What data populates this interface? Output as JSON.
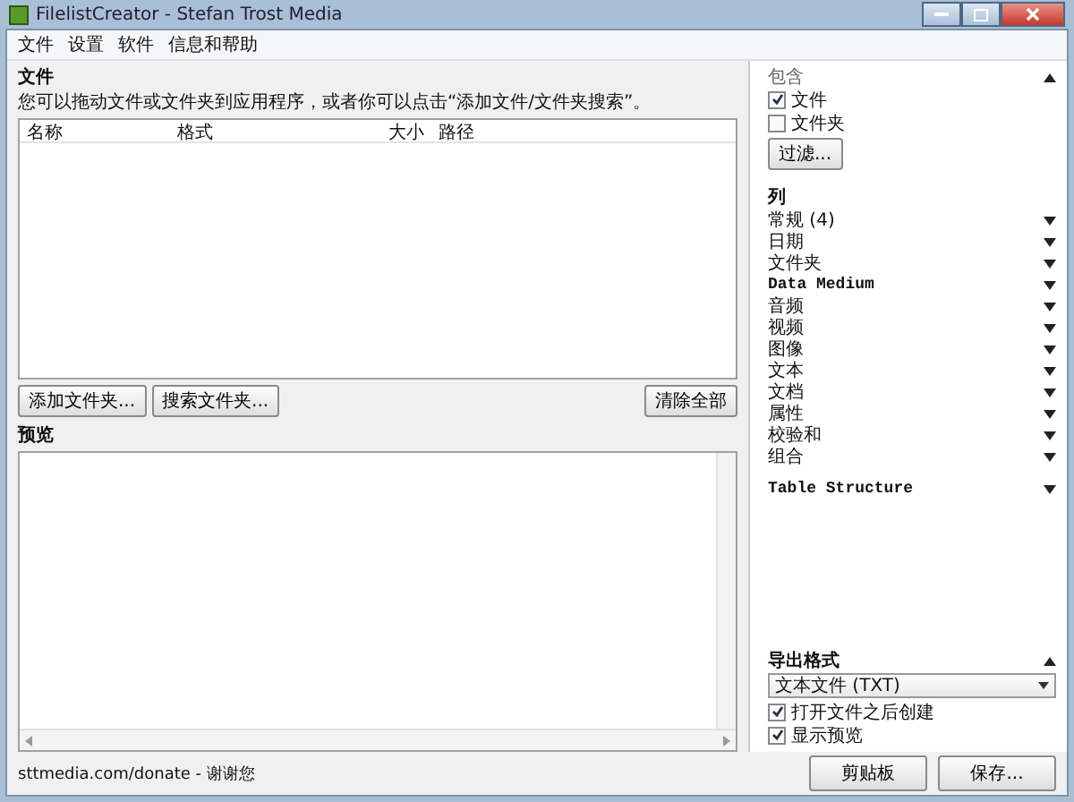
{
  "window": {
    "title": "FilelistCreator - Stefan Trost Media"
  },
  "menu": [
    "文件",
    "设置",
    "软件",
    "信息和帮助"
  ],
  "files": {
    "heading": "文件",
    "description": "您可以拖动文件或文件夹到应用程序，或者你可以点击“添加文件/文件夹搜索”。",
    "columns": [
      "名称",
      "格式",
      "大小",
      "路径"
    ],
    "buttons": [
      "添加文件夹...",
      "搜索文件夹..."
    ],
    "clear_button": "清除全部"
  },
  "preview": {
    "heading": "预览"
  },
  "include": {
    "title": "包含",
    "expanded": true,
    "options": [
      {
        "label": "文件",
        "checked": true
      },
      {
        "label": "文件夹",
        "checked": false
      }
    ],
    "filter_button": "过滤..."
  },
  "columns_panel": {
    "heading": "列",
    "groups": [
      {
        "label": "常规 (4)",
        "kind": "text",
        "expanded": false
      },
      {
        "label": "日期",
        "kind": "text",
        "expanded": false
      },
      {
        "label": "文件夹",
        "kind": "text",
        "expanded": false
      },
      {
        "label": "Data Medium",
        "kind": "mono",
        "expanded": false
      },
      {
        "label": "音频",
        "kind": "text",
        "expanded": false
      },
      {
        "label": "视频",
        "kind": "text",
        "expanded": false
      },
      {
        "label": "图像",
        "kind": "text",
        "expanded": false
      },
      {
        "label": "文本",
        "kind": "text",
        "expanded": false
      },
      {
        "label": "文档",
        "kind": "text",
        "expanded": false
      },
      {
        "label": "属性",
        "kind": "text",
        "expanded": false
      },
      {
        "label": "校验和",
        "kind": "text",
        "expanded": false
      },
      {
        "label": "组合",
        "kind": "text",
        "expanded": false
      }
    ]
  },
  "table_structure": {
    "label": "Table Structure",
    "expanded": false
  },
  "export": {
    "title": "导出格式",
    "expanded": true,
    "format": "文本文件 (TXT)",
    "options": [
      {
        "label": "打开文件之后创建",
        "checked": true
      },
      {
        "label": "显示预览",
        "checked": true
      }
    ]
  },
  "status": {
    "donate": "sttmedia.com/donate - 谢谢您"
  },
  "actions": [
    "剪贴板",
    "保存..."
  ]
}
